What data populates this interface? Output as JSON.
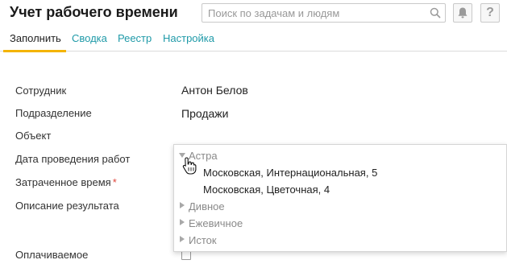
{
  "header": {
    "title": "Учет рабочего времени",
    "search_placeholder": "Поиск по задачам и людям",
    "icons": [
      "search-icon",
      "bell-icon",
      "help-icon"
    ],
    "help_label": "?"
  },
  "tabs": [
    {
      "label": "Заполнить",
      "active": true
    },
    {
      "label": "Сводка",
      "active": false
    },
    {
      "label": "Реестр",
      "active": false
    },
    {
      "label": "Настройка",
      "active": false
    }
  ],
  "form": {
    "employee_label": "Сотрудник",
    "employee_value": "Антон Белов",
    "department_label": "Подразделение",
    "department_value": "Продажи",
    "object_label": "Объект",
    "work_date_label": "Дата проведения работ",
    "time_spent_label": "Затраченное время",
    "required_mark": "*",
    "result_description_label": "Описание результата",
    "billable_label": "Оплачиваемое",
    "billable_checked": false
  },
  "object_dropdown": {
    "items": [
      {
        "label": "Астра",
        "kind": "group",
        "expanded": true
      },
      {
        "label": "Московская, Интернациональная, 5",
        "kind": "leaf"
      },
      {
        "label": "Московская, Цветочная, 4",
        "kind": "leaf"
      },
      {
        "label": "Дивное",
        "kind": "group",
        "expanded": false
      },
      {
        "label": "Ежевичное",
        "kind": "group",
        "expanded": false
      },
      {
        "label": "Исток",
        "kind": "group",
        "expanded": false
      }
    ]
  },
  "colors": {
    "accent_link": "#1f9aa8",
    "active_tab_underline": "#f4b400",
    "required_star": "#e0453a"
  }
}
